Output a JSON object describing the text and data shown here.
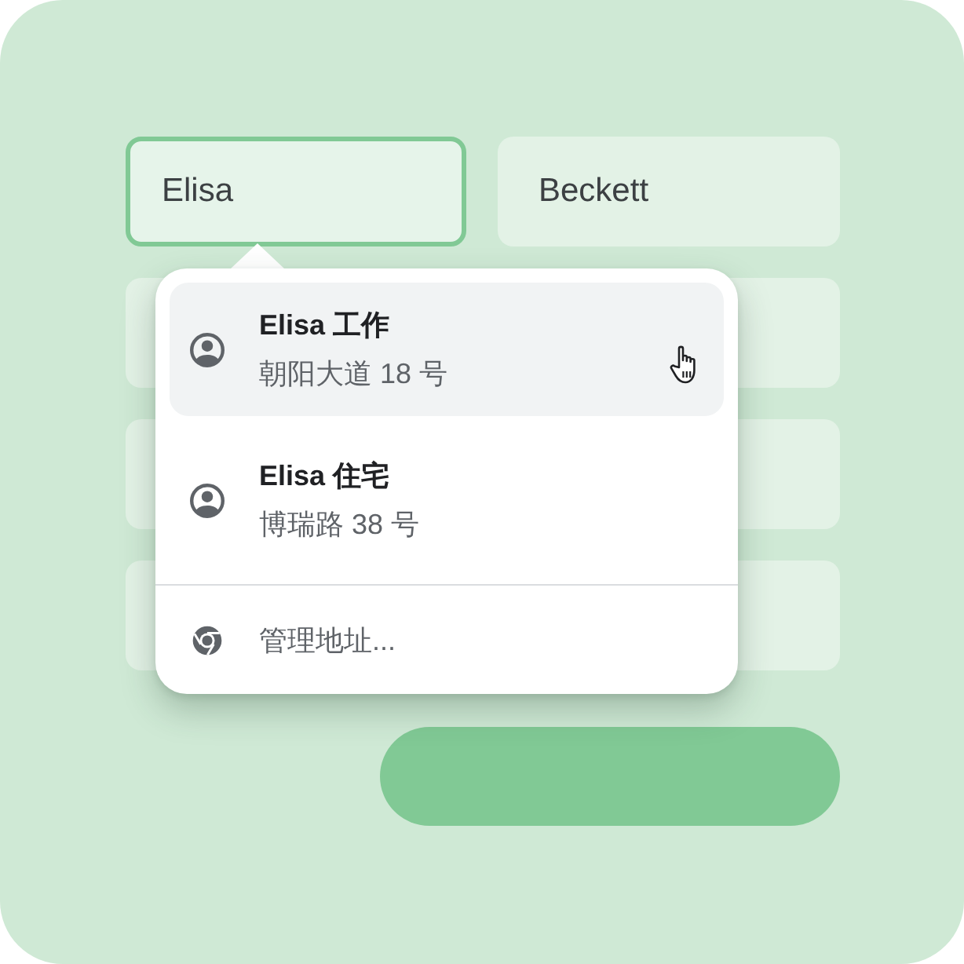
{
  "form": {
    "fields": [
      {
        "value": "Elisa",
        "focused": true
      },
      {
        "value": "Beckett",
        "focused": false
      },
      {
        "focused": false
      },
      {
        "focused": false
      },
      {
        "focused": false
      },
      {
        "focused": false
      },
      {
        "focused": false
      },
      {
        "focused": false
      }
    ]
  },
  "autofill_dropdown": {
    "suggestions": [
      {
        "title": "Elisa 工作",
        "address": "朝阳大道 18 号",
        "selected": true
      },
      {
        "title": "Elisa 住宅",
        "address": "博瑞路 38 号",
        "selected": false
      }
    ],
    "manage_link": {
      "label": "管理地址..."
    }
  }
}
